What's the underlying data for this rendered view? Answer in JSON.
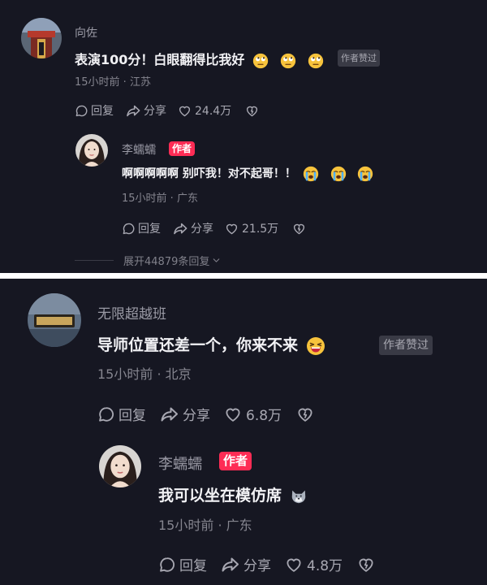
{
  "comment1": {
    "username": "向佐",
    "text": "表演100分！白眼翻得比我好",
    "liked_badge": "作者赞过",
    "meta": "15小时前 · 江苏",
    "reply_label": "回复",
    "share_label": "分享",
    "like_count": "24.4万",
    "emoji_icons": [
      "eye-roll-emoji",
      "eye-roll-emoji",
      "eye-roll-emoji"
    ],
    "reply": {
      "username": "李蠕蠕",
      "author_badge": "作者",
      "text": "啊啊啊啊啊 别吓我！对不起哥！！",
      "meta": "15小时前 · 广东",
      "reply_label": "回复",
      "share_label": "分享",
      "like_count": "21.5万",
      "emoji_icons": [
        "crying-emoji",
        "crying-emoji",
        "crying-emoji"
      ]
    },
    "expand_label": "展开44879条回复"
  },
  "comment2": {
    "username": "无限超越班",
    "text": "导师位置还差一个，你来不来",
    "liked_badge": "作者赞过",
    "meta": "15小时前 · 北京",
    "reply_label": "回复",
    "share_label": "分享",
    "like_count": "6.8万",
    "emoji_icons": [
      "squinting-laugh-emoji"
    ],
    "reply": {
      "username": "李蠕蠕",
      "author_badge": "作者",
      "text": "我可以坐在模仿席",
      "meta": "15小时前 · 广东",
      "reply_label": "回复",
      "share_label": "分享",
      "like_count": "4.8万",
      "emoji_icons": [
        "wolf-emoji"
      ]
    }
  },
  "colors": {
    "background": "#161722",
    "author_badge": "#fe2c55",
    "liked_badge_bg": "#393a45",
    "separator": "#ffffff"
  }
}
